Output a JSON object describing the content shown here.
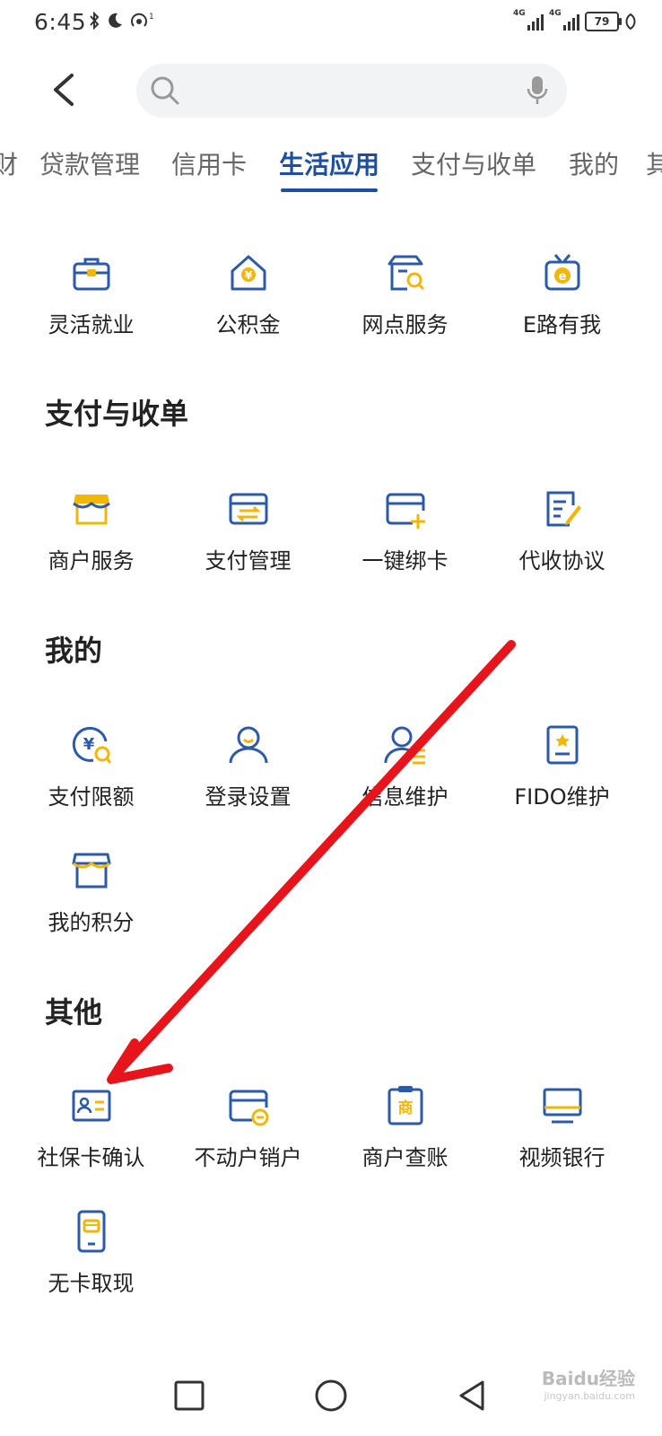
{
  "status_bar": {
    "time": "6:45",
    "signal1_label": "4G",
    "signal2_label": "4G",
    "battery_level": "79"
  },
  "search": {
    "placeholder": ""
  },
  "tabs": [
    {
      "label": "财"
    },
    {
      "label": "贷款管理"
    },
    {
      "label": "信用卡"
    },
    {
      "label": "生活应用",
      "active": true
    },
    {
      "label": "支付与收单"
    },
    {
      "label": "我的"
    },
    {
      "label": "其"
    }
  ],
  "sections": {
    "life": {
      "items": [
        {
          "label": "灵活就业",
          "icon": "briefcase-icon"
        },
        {
          "label": "公积金",
          "icon": "house-yuan-icon"
        },
        {
          "label": "网点服务",
          "icon": "branch-search-icon"
        },
        {
          "label": "E路有我",
          "icon": "tv-e-icon"
        }
      ]
    },
    "payment": {
      "title": "支付与收单",
      "items": [
        {
          "label": "商户服务",
          "icon": "storefront-icon"
        },
        {
          "label": "支付管理",
          "icon": "card-transfer-icon"
        },
        {
          "label": "一键绑卡",
          "icon": "card-add-icon"
        },
        {
          "label": "代收协议",
          "icon": "document-edit-icon"
        }
      ]
    },
    "mine": {
      "title": "我的",
      "items": [
        {
          "label": "支付限额",
          "icon": "yuan-limit-icon"
        },
        {
          "label": "登录设置",
          "icon": "user-icon"
        },
        {
          "label": "信息维护",
          "icon": "user-list-icon"
        },
        {
          "label": "FIDO维护",
          "icon": "fido-badge-icon"
        },
        {
          "label": "我的积分",
          "icon": "points-store-icon"
        }
      ]
    },
    "other": {
      "title": "其他",
      "items": [
        {
          "label": "社保卡确认",
          "icon": "id-card-icon"
        },
        {
          "label": "不动户销户",
          "icon": "card-minus-icon"
        },
        {
          "label": "商户查账",
          "icon": "merchant-clipboard-icon"
        },
        {
          "label": "视频银行",
          "icon": "monitor-icon"
        },
        {
          "label": "无卡取现",
          "icon": "phone-card-icon"
        }
      ]
    }
  },
  "nav": {
    "recent": "square-icon",
    "home": "circle-icon",
    "back": "triangle-back-icon"
  },
  "watermark": {
    "text": "Baidu经验",
    "sub": "jingyan.baidu.com"
  },
  "colors": {
    "accent": "#1f4e9e",
    "icon_blue": "#2d5aa8",
    "icon_yellow": "#f2b705",
    "arrow": "#e8141b"
  }
}
